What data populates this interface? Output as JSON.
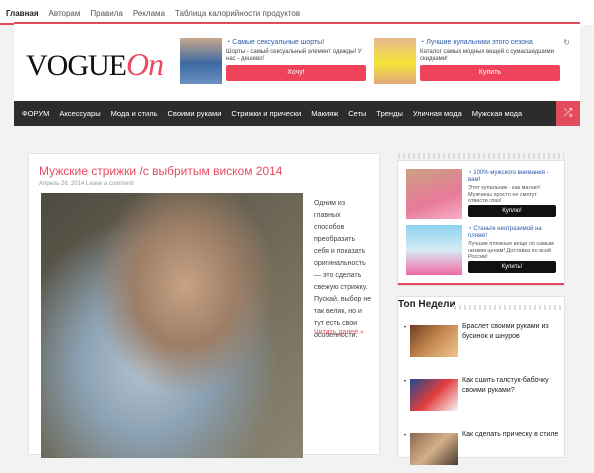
{
  "topnav": {
    "items": [
      "Главная",
      "Авторам",
      "Правила",
      "Реклама",
      "Таблица калорийности продуктов"
    ]
  },
  "logo": {
    "main": "VOGUE",
    "accent": "On"
  },
  "header_ads": [
    {
      "title": "Самые сексуальные шорты!",
      "desc": "Шорты - самый сексуальный элемент одежды! У нас - дешево!",
      "button": "Хочу!"
    },
    {
      "title": "Лучшие купальники этого сезона",
      "desc": "Каталог самых модных вещей с сумасшедшими скидками!",
      "button": "Купить"
    }
  ],
  "mainnav": {
    "items": [
      "ФОРУМ",
      "Аксессуары",
      "Мода и стиль",
      "Своими руками",
      "Стрижки и прически",
      "Макияж",
      "Сеты",
      "Тренды",
      "Уличная мода",
      "Мужская мода"
    ]
  },
  "post": {
    "title": "Мужские стрижки /с выбритым виском 2014",
    "meta": "Апрель 26, 2014 Leave a comment",
    "excerpt": "Одним из главных способов преобразить себя и показать оригинальность — это сделать свежую стрижку. Пускай, выбор не так велик, но и тут есть свои особенности.",
    "more": "Читать далее »"
  },
  "sidebar_ads": [
    {
      "title": "100% мужского внимания - вам!",
      "desc": "Этот купальник - как магнит! Мужчины просто не смогут отвести глаз!",
      "button": "Куплю!"
    },
    {
      "title": "Станьте неотразимой на пляже!",
      "desc": "Лучшие пляжные вещи по самым низким ценам! Доставка по всей России!",
      "button": "Купить!"
    }
  ],
  "topweek": {
    "heading": "Топ Недели",
    "items": [
      {
        "text": "Браслет своими руками из бусинок и шнуров"
      },
      {
        "text": "Как сшить галстук-бабочку своими руками?"
      },
      {
        "text": "Как сделать прическу в стиле"
      }
    ]
  },
  "colors": {
    "accent": "#e34a5b",
    "nav_bg": "#2c2c2c",
    "link": "#2a59a7"
  }
}
